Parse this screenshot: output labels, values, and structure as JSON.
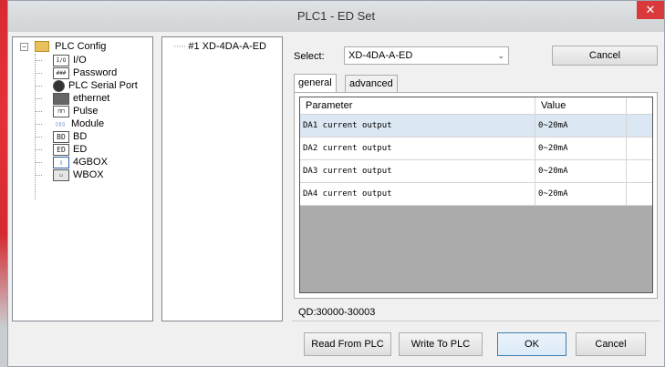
{
  "window": {
    "title": "PLC1 - ED  Set"
  },
  "tree": {
    "root": "PLC Config",
    "items": [
      {
        "icon": "io-icon",
        "glyph": "I/O",
        "label": "I/O"
      },
      {
        "icon": "password-icon",
        "glyph": "###",
        "label": "Password"
      },
      {
        "icon": "serial-port-icon",
        "glyph": "",
        "label": "PLC Serial Port"
      },
      {
        "icon": "ethernet-icon",
        "glyph": "",
        "label": "ethernet"
      },
      {
        "icon": "pulse-icon",
        "glyph": "⊓⊓",
        "label": "Pulse"
      },
      {
        "icon": "module-icon",
        "glyph": "▯▯▯",
        "label": "Module"
      },
      {
        "icon": "bd-icon",
        "glyph": "BD",
        "label": "BD"
      },
      {
        "icon": "ed-icon",
        "glyph": "ED",
        "label": "ED"
      },
      {
        "icon": "4gbox-icon",
        "glyph": "▯",
        "label": "4GBOX"
      },
      {
        "icon": "wbox-icon",
        "glyph": "▭",
        "label": "WBOX"
      }
    ]
  },
  "modules": {
    "items": [
      "#1 XD-4DA-A-ED"
    ]
  },
  "select": {
    "label": "Select:",
    "value": "XD-4DA-A-ED",
    "cancel": "Cancel"
  },
  "tabs": [
    "general",
    "advanced"
  ],
  "table": {
    "headers": [
      "Parameter",
      "Value"
    ],
    "rows": [
      [
        "DA1 current output",
        "0~20mA"
      ],
      [
        "DA2 current output",
        "0~20mA"
      ],
      [
        "DA3 current output",
        "0~20mA"
      ],
      [
        "DA4 current output",
        "0~20mA"
      ]
    ]
  },
  "address": "QD:30000-30003",
  "footer": {
    "read": "Read From PLC",
    "write": "Write To PLC",
    "ok": "OK",
    "cancel": "Cancel"
  }
}
